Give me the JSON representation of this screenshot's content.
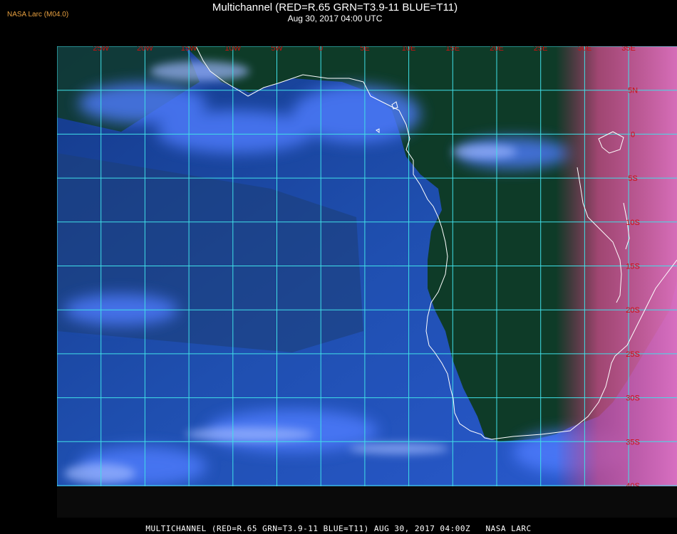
{
  "header": {
    "producer": "NASA Larc (M04.0)",
    "title": "Multichannel (RED=R.65 GRN=T3.9-11 BLUE=T11)",
    "timestamp": "Aug 30, 2017 04:00 UTC"
  },
  "map": {
    "lon_labels": [
      "25W",
      "20W",
      "15W",
      "10W",
      "5W",
      "0",
      "5E",
      "10E",
      "15E",
      "20E",
      "25E",
      "30E",
      "35E"
    ],
    "lat_labels": [
      "5N",
      "0",
      "5S",
      "10S",
      "15S",
      "20S",
      "25S",
      "30S",
      "35S",
      "40S"
    ],
    "colors": {
      "grid": "#40e0e8",
      "label": "#cc1010",
      "coast": "#ffffff",
      "ocean": "#1a45a0",
      "land_dark": "#0d3a24",
      "cloud": "#4a7dff",
      "land_day": "#c050a0"
    }
  },
  "footer": {
    "text": "MULTICHANNEL (RED=R.65 GRN=T3.9-11 BLUE=T11) AUG 30, 2017 04:00Z   NASA LARC"
  }
}
